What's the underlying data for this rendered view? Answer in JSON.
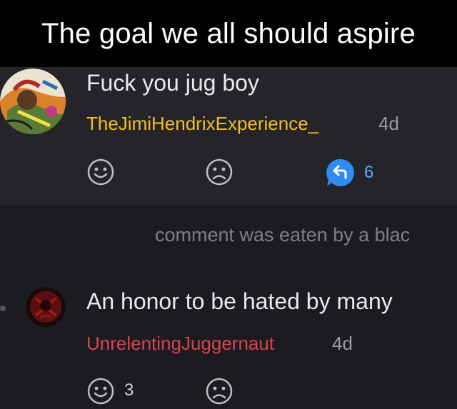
{
  "caption": {
    "text": "The goal we all should aspire"
  },
  "comments": [
    {
      "body": "Fuck you jug boy",
      "author": "TheJimiHendrixExperience_",
      "author_color": "#f2bd2c",
      "age": "4d",
      "reply_count": "6"
    },
    {
      "body": "An honor to be hated by many",
      "author": "UnrelentingJuggernaut",
      "author_color": "#d9444d",
      "age": "4d",
      "upvote_count": "3"
    }
  ],
  "deleted_notice": "comment was eaten by a blac",
  "colors": {
    "background": "#1c1c20",
    "card": "#252529",
    "reply_accent": "#2f8cf0"
  },
  "icons": [
    "happy-face-icon",
    "sad-face-icon",
    "reply-arrow-icon"
  ]
}
